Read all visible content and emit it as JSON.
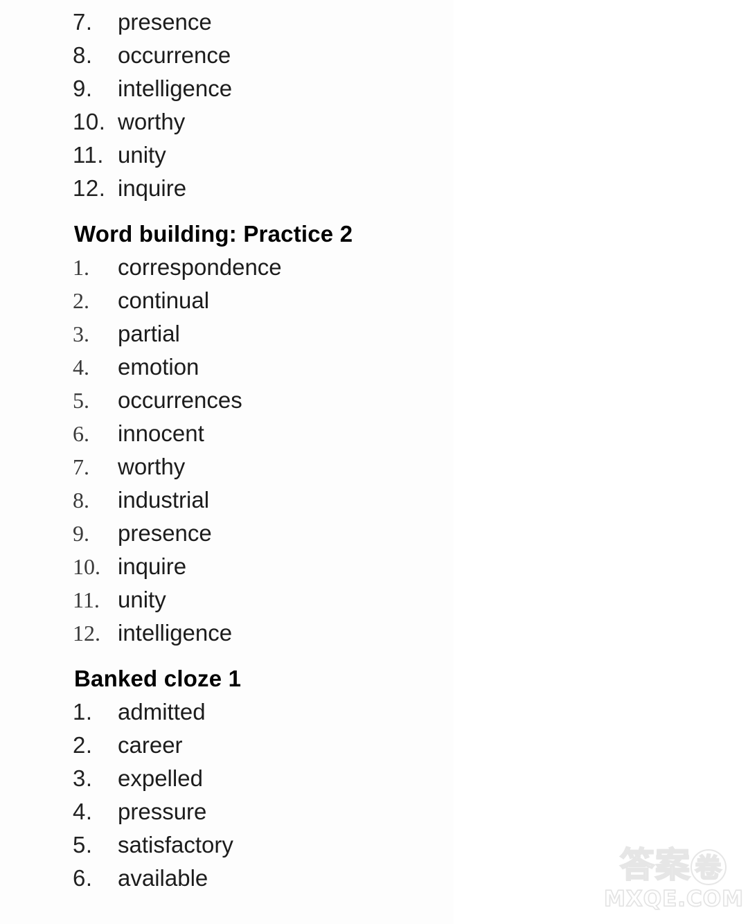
{
  "page": {
    "background_color": "#ffffff",
    "text_color": "#1a1a1a"
  },
  "sections": [
    {
      "id": "word-building-practice-1-continued",
      "heading": null,
      "number_style": "sans",
      "items": [
        {
          "number": "7.",
          "word": "presence"
        },
        {
          "number": "8.",
          "word": "occurrence"
        },
        {
          "number": "9.",
          "word": "intelligence"
        },
        {
          "number": "10.",
          "word": "worthy"
        },
        {
          "number": "11.",
          "word": "unity"
        },
        {
          "number": "12.",
          "word": "inquire"
        }
      ]
    },
    {
      "id": "word-building-practice-2",
      "heading": "Word building: Practice 2",
      "number_style": "serif",
      "items": [
        {
          "number": "1.",
          "word": "correspondence"
        },
        {
          "number": "2.",
          "word": "continual"
        },
        {
          "number": "3.",
          "word": "partial"
        },
        {
          "number": "4.",
          "word": "emotion"
        },
        {
          "number": "5.",
          "word": "occurrences"
        },
        {
          "number": "6.",
          "word": "innocent"
        },
        {
          "number": "7.",
          "word": "worthy"
        },
        {
          "number": "8.",
          "word": "industrial"
        },
        {
          "number": "9.",
          "word": "presence"
        },
        {
          "number": "10.",
          "word": "inquire"
        },
        {
          "number": "11.",
          "word": "unity"
        },
        {
          "number": "12.",
          "word": "intelligence"
        }
      ]
    },
    {
      "id": "banked-cloze-1",
      "heading": "Banked cloze 1",
      "number_style": "sans",
      "items": [
        {
          "number": "1.",
          "word": "admitted"
        },
        {
          "number": "2.",
          "word": "career"
        },
        {
          "number": "3.",
          "word": "expelled"
        },
        {
          "number": "4.",
          "word": "pressure"
        },
        {
          "number": "5.",
          "word": "satisfactory"
        },
        {
          "number": "6.",
          "word": "available"
        }
      ]
    }
  ],
  "watermark": {
    "chinese_main": "答案",
    "chinese_circled": "卷",
    "domain": "MXQE.COM",
    "color": "#e8e8e8"
  }
}
